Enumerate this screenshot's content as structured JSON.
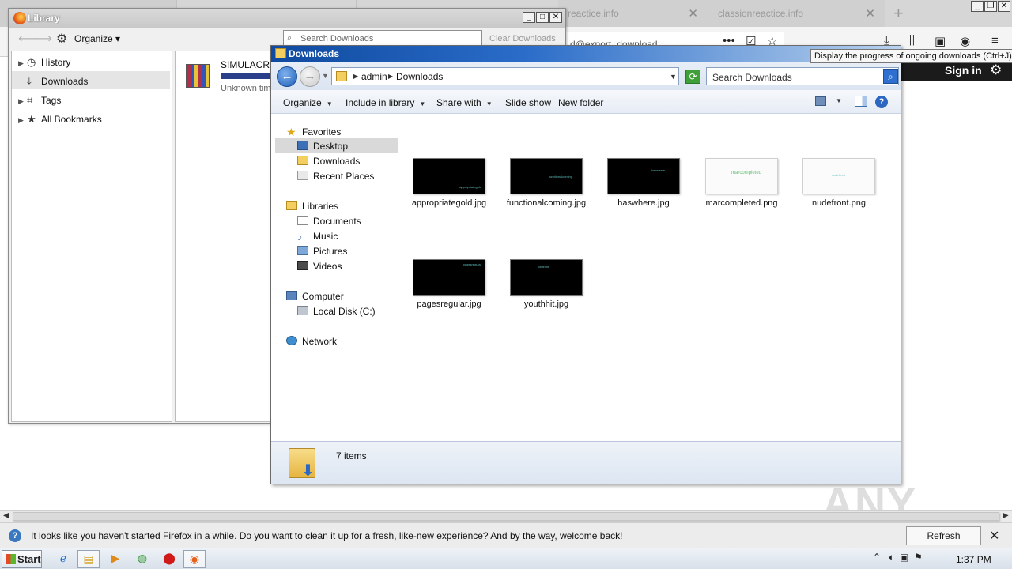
{
  "firefox": {
    "tabs": [
      {
        "label": "reactice.info"
      },
      {
        "label": "classionreactice.info"
      }
    ],
    "url_text": "d@export=download",
    "sign_in": "Sign in"
  },
  "library": {
    "title": "Library",
    "organize": "Organize",
    "search_placeholder": "Search Downloads",
    "clear": "Clear Downloads",
    "tree": [
      {
        "label": "History"
      },
      {
        "label": "Downloads"
      },
      {
        "label": "Tags"
      },
      {
        "label": "All Bookmarks"
      }
    ],
    "download": {
      "name": "SIMULACRA.r",
      "status": "Unknown time"
    }
  },
  "explorer": {
    "title": "Downloads",
    "breadcrumb": [
      "admin",
      "Downloads"
    ],
    "search_placeholder": "Search Downloads",
    "commands": [
      "Organize",
      "Include in library",
      "Share with",
      "Slide show",
      "New folder"
    ],
    "nav": {
      "favorites_header": "Favorites",
      "favorites": [
        "Desktop",
        "Downloads",
        "Recent Places"
      ],
      "libraries_header": "Libraries",
      "libraries": [
        "Documents",
        "Music",
        "Pictures",
        "Videos"
      ],
      "computer_header": "Computer",
      "computer": [
        "Local Disk (C:)"
      ],
      "network": "Network"
    },
    "files": [
      {
        "name": "appropriategold.jpg",
        "thumb_text": "appropriategold"
      },
      {
        "name": "functionalcoming.jpg",
        "thumb_text": "functionalcoming"
      },
      {
        "name": "haswhere.jpg",
        "thumb_text": "haswhere"
      },
      {
        "name": "marcompleted.png",
        "thumb_text": "marcompleted"
      },
      {
        "name": "nudefront.png",
        "thumb_text": "nudefront"
      },
      {
        "name": "pagesregular.jpg",
        "thumb_text": "pagesregular"
      },
      {
        "name": "youthhit.jpg",
        "thumb_text": "youthhit"
      }
    ],
    "status": "7 items"
  },
  "tooltip": "Display the progress of ongoing downloads (Ctrl+J)",
  "notification": {
    "text": "It looks like you haven't started Firefox in a while. Do you want to clean it up for a fresh, like-new experience? And by the way, welcome back!",
    "button": "Refresh Firefox…"
  },
  "taskbar": {
    "start": "Start",
    "clock": "1:37 PM"
  },
  "watermark": "ANY RUN"
}
